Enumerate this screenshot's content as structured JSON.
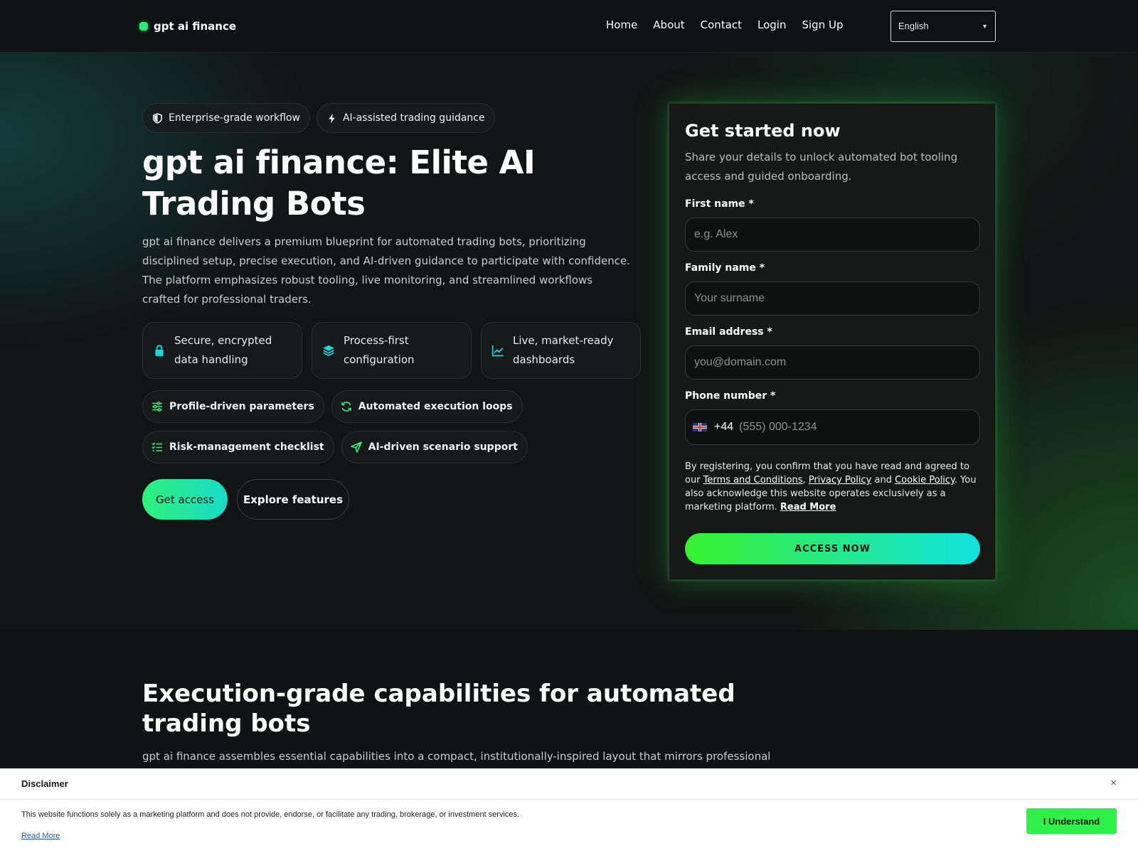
{
  "nav": {
    "brand": "gpt ai finance",
    "links": [
      "Home",
      "About",
      "Contact",
      "Login",
      "Sign Up"
    ],
    "language": "English"
  },
  "hero": {
    "chips_top": [
      {
        "icon": "shield-icon",
        "label": "Enterprise-grade workflow"
      },
      {
        "icon": "bolt-icon",
        "label": "AI-assisted trading guidance"
      }
    ],
    "title": "gpt ai finance: Elite AI Trading Bots",
    "description": "gpt ai finance delivers a premium blueprint for automated trading bots, prioritizing disciplined setup, precise execution, and AI-driven guidance to participate with confidence. The platform emphasizes robust tooling, live monitoring, and streamlined workflows crafted for professional traders.",
    "feature_cards": [
      {
        "icon": "lock-icon",
        "label": "Secure, encrypted data handling"
      },
      {
        "icon": "layers-icon",
        "label": "Process-first configuration"
      },
      {
        "icon": "chart-line-icon",
        "label": "Live, market-ready dashboards"
      }
    ],
    "chips_row1": [
      {
        "icon": "sliders-icon",
        "label": "Profile-driven parameters"
      },
      {
        "icon": "refresh-icon",
        "label": "Automated execution loops"
      }
    ],
    "chips_row2": [
      {
        "icon": "checklist-icon",
        "label": "Risk-management checklist"
      },
      {
        "icon": "send-icon",
        "label": "AI-driven scenario support"
      }
    ],
    "btn_access": "Get access",
    "btn_explore": "Explore features"
  },
  "form": {
    "title": "Get started now",
    "subtitle": "Share your details to unlock automated bot tooling access and guided onboarding.",
    "first_name_label": "First name *",
    "first_name_placeholder": "e.g. Alex",
    "family_name_label": "Family name *",
    "family_name_placeholder": "Your surname",
    "email_label": "Email address *",
    "email_placeholder": "you@domain.com",
    "phone_label": "Phone number *",
    "phone_dial": "+44",
    "phone_placeholder": "(555) 000-1234",
    "consent_prefix": "By registering, you confirm that you have read and agreed to our ",
    "terms": "Terms and Conditions",
    "privacy": "Privacy Policy",
    "and": " and ",
    "cookie": "Cookie Policy",
    "consent_suffix": ". You also acknowledge this website operates exclusively as a marketing platform. ",
    "read_more": "Read More",
    "submit": "ACCESS NOW"
  },
  "section2": {
    "title": "Execution-grade capabilities for automated trading bots",
    "desc": "gpt ai finance assembles essential capabilities into a compact, institutionally-inspired layout that mirrors professional"
  },
  "disclaimer": {
    "title": "Disclaimer",
    "close": "×",
    "text": "This website functions solely as a marketing platform and does not provide, endorse, or facilitate any trading, brokerage, or investment services.",
    "read_more": "Read More",
    "button": "I Understand"
  },
  "colors": {
    "accent_green": "#2ff07a",
    "accent_cyan": "#17dcc9",
    "background": "#111213"
  }
}
